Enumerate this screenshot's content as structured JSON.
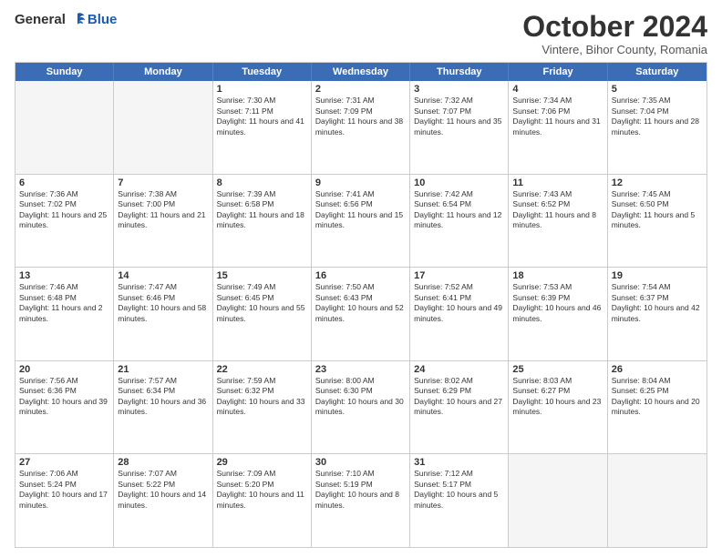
{
  "header": {
    "logo_general": "General",
    "logo_blue": "Blue",
    "month_title": "October 2024",
    "subtitle": "Vintere, Bihor County, Romania"
  },
  "days_of_week": [
    "Sunday",
    "Monday",
    "Tuesday",
    "Wednesday",
    "Thursday",
    "Friday",
    "Saturday"
  ],
  "weeks": [
    [
      {
        "day": "",
        "info": "",
        "empty": true
      },
      {
        "day": "",
        "info": "",
        "empty": true
      },
      {
        "day": "1",
        "info": "Sunrise: 7:30 AM\nSunset: 7:11 PM\nDaylight: 11 hours and 41 minutes."
      },
      {
        "day": "2",
        "info": "Sunrise: 7:31 AM\nSunset: 7:09 PM\nDaylight: 11 hours and 38 minutes."
      },
      {
        "day": "3",
        "info": "Sunrise: 7:32 AM\nSunset: 7:07 PM\nDaylight: 11 hours and 35 minutes."
      },
      {
        "day": "4",
        "info": "Sunrise: 7:34 AM\nSunset: 7:06 PM\nDaylight: 11 hours and 31 minutes."
      },
      {
        "day": "5",
        "info": "Sunrise: 7:35 AM\nSunset: 7:04 PM\nDaylight: 11 hours and 28 minutes."
      }
    ],
    [
      {
        "day": "6",
        "info": "Sunrise: 7:36 AM\nSunset: 7:02 PM\nDaylight: 11 hours and 25 minutes."
      },
      {
        "day": "7",
        "info": "Sunrise: 7:38 AM\nSunset: 7:00 PM\nDaylight: 11 hours and 21 minutes."
      },
      {
        "day": "8",
        "info": "Sunrise: 7:39 AM\nSunset: 6:58 PM\nDaylight: 11 hours and 18 minutes."
      },
      {
        "day": "9",
        "info": "Sunrise: 7:41 AM\nSunset: 6:56 PM\nDaylight: 11 hours and 15 minutes."
      },
      {
        "day": "10",
        "info": "Sunrise: 7:42 AM\nSunset: 6:54 PM\nDaylight: 11 hours and 12 minutes."
      },
      {
        "day": "11",
        "info": "Sunrise: 7:43 AM\nSunset: 6:52 PM\nDaylight: 11 hours and 8 minutes."
      },
      {
        "day": "12",
        "info": "Sunrise: 7:45 AM\nSunset: 6:50 PM\nDaylight: 11 hours and 5 minutes."
      }
    ],
    [
      {
        "day": "13",
        "info": "Sunrise: 7:46 AM\nSunset: 6:48 PM\nDaylight: 11 hours and 2 minutes."
      },
      {
        "day": "14",
        "info": "Sunrise: 7:47 AM\nSunset: 6:46 PM\nDaylight: 10 hours and 58 minutes."
      },
      {
        "day": "15",
        "info": "Sunrise: 7:49 AM\nSunset: 6:45 PM\nDaylight: 10 hours and 55 minutes."
      },
      {
        "day": "16",
        "info": "Sunrise: 7:50 AM\nSunset: 6:43 PM\nDaylight: 10 hours and 52 minutes."
      },
      {
        "day": "17",
        "info": "Sunrise: 7:52 AM\nSunset: 6:41 PM\nDaylight: 10 hours and 49 minutes."
      },
      {
        "day": "18",
        "info": "Sunrise: 7:53 AM\nSunset: 6:39 PM\nDaylight: 10 hours and 46 minutes."
      },
      {
        "day": "19",
        "info": "Sunrise: 7:54 AM\nSunset: 6:37 PM\nDaylight: 10 hours and 42 minutes."
      }
    ],
    [
      {
        "day": "20",
        "info": "Sunrise: 7:56 AM\nSunset: 6:36 PM\nDaylight: 10 hours and 39 minutes."
      },
      {
        "day": "21",
        "info": "Sunrise: 7:57 AM\nSunset: 6:34 PM\nDaylight: 10 hours and 36 minutes."
      },
      {
        "day": "22",
        "info": "Sunrise: 7:59 AM\nSunset: 6:32 PM\nDaylight: 10 hours and 33 minutes."
      },
      {
        "day": "23",
        "info": "Sunrise: 8:00 AM\nSunset: 6:30 PM\nDaylight: 10 hours and 30 minutes."
      },
      {
        "day": "24",
        "info": "Sunrise: 8:02 AM\nSunset: 6:29 PM\nDaylight: 10 hours and 27 minutes."
      },
      {
        "day": "25",
        "info": "Sunrise: 8:03 AM\nSunset: 6:27 PM\nDaylight: 10 hours and 23 minutes."
      },
      {
        "day": "26",
        "info": "Sunrise: 8:04 AM\nSunset: 6:25 PM\nDaylight: 10 hours and 20 minutes."
      }
    ],
    [
      {
        "day": "27",
        "info": "Sunrise: 7:06 AM\nSunset: 5:24 PM\nDaylight: 10 hours and 17 minutes."
      },
      {
        "day": "28",
        "info": "Sunrise: 7:07 AM\nSunset: 5:22 PM\nDaylight: 10 hours and 14 minutes."
      },
      {
        "day": "29",
        "info": "Sunrise: 7:09 AM\nSunset: 5:20 PM\nDaylight: 10 hours and 11 minutes."
      },
      {
        "day": "30",
        "info": "Sunrise: 7:10 AM\nSunset: 5:19 PM\nDaylight: 10 hours and 8 minutes."
      },
      {
        "day": "31",
        "info": "Sunrise: 7:12 AM\nSunset: 5:17 PM\nDaylight: 10 hours and 5 minutes."
      },
      {
        "day": "",
        "info": "",
        "empty": true
      },
      {
        "day": "",
        "info": "",
        "empty": true
      }
    ]
  ]
}
